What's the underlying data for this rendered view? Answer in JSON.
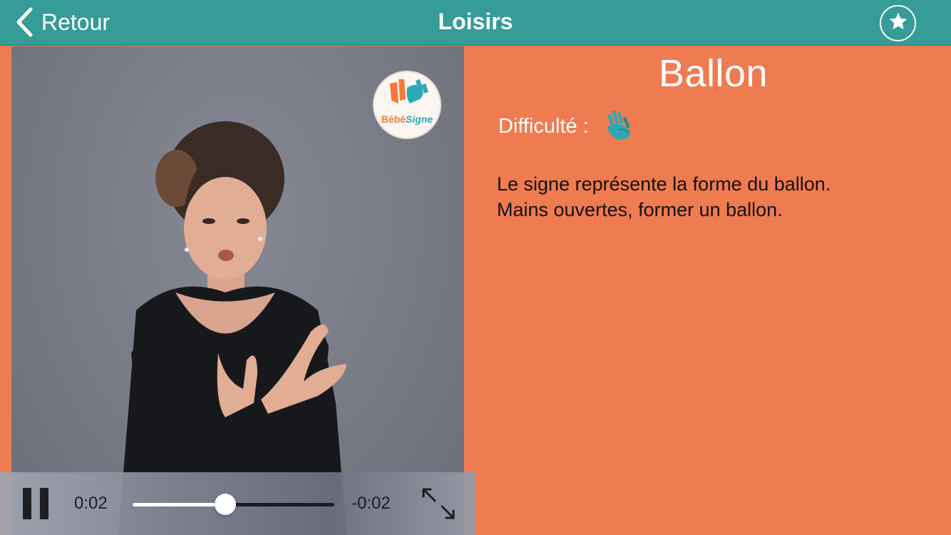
{
  "navbar": {
    "back_label": "Retour",
    "title": "Loisirs",
    "favorite_icon": "star-icon",
    "background": "#359c97"
  },
  "video": {
    "logo": {
      "part1": "Bébé",
      "part2": "Signe"
    },
    "player": {
      "elapsed": "0:02",
      "remaining": "-0:02",
      "progress": 0.46,
      "play_state_icon": "pause-icon",
      "fullscreen_icon": "expand-icon"
    }
  },
  "content": {
    "word": "Ballon",
    "difficulty_label": "Difficulté :",
    "difficulty_icon": "hands-icon",
    "description_line1": "Le signe représente la forme du ballon.",
    "description_line2": "Mains ouvertes, former un ballon.",
    "background": "#ef7b50"
  }
}
